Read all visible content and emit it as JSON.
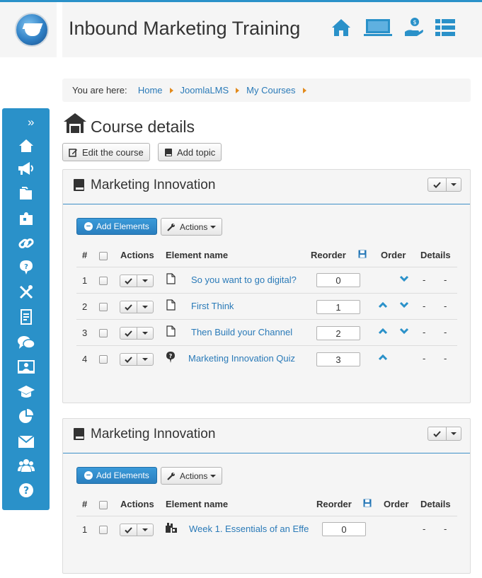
{
  "header": {
    "title": "Inbound Marketing Training",
    "icons": [
      "home-icon",
      "monitor-icon",
      "money-hand-icon",
      "list-icon"
    ]
  },
  "breadcrumb": {
    "prefix": "You are here:",
    "items": [
      "Home",
      "JoomlaLMS",
      "My Courses"
    ]
  },
  "sidebar": {
    "expand_glyph": "»",
    "icons": [
      "home-icon",
      "megaphone-icon",
      "folders-icon",
      "puzzle-icon",
      "link-icon",
      "help-bubble-icon",
      "tools-icon",
      "clipboard-icon",
      "chat-icon",
      "presentation-icon",
      "graduation-cap-icon",
      "pie-chart-icon",
      "mail-icon",
      "users-icon",
      "question-icon"
    ]
  },
  "page": {
    "title": "Course details",
    "edit_button": "Edit the course",
    "add_topic_button": "Add topic"
  },
  "columns": {
    "num": "#",
    "actions": "Actions",
    "element_name": "Element name",
    "reorder": "Reorder",
    "order": "Order",
    "details": "Details"
  },
  "topics": [
    {
      "title": "Marketing Innovation",
      "add_elements": "Add Elements",
      "actions": "Actions",
      "rows": [
        {
          "num": "1",
          "name": "So you want to go digital?",
          "icon": "document-icon",
          "reorder": "0",
          "up": false,
          "down": true,
          "d1": "-",
          "d2": "-"
        },
        {
          "num": "2",
          "name": "First Think",
          "icon": "document-icon",
          "reorder": "1",
          "up": true,
          "down": true,
          "d1": "-",
          "d2": "-"
        },
        {
          "num": "3",
          "name": "Then Build your Channel",
          "icon": "document-icon",
          "reorder": "2",
          "up": true,
          "down": true,
          "d1": "-",
          "d2": "-"
        },
        {
          "num": "4",
          "name": "Marketing Innovation Quiz",
          "icon": "quiz-icon",
          "reorder": "3",
          "up": true,
          "down": false,
          "d1": "-",
          "d2": "-"
        }
      ]
    },
    {
      "title": "Marketing Innovation",
      "add_elements": "Add Elements",
      "actions": "Actions",
      "rows": [
        {
          "num": "1",
          "name": "Week 1. Essentials of an Effe",
          "icon": "scorm-icon",
          "reorder": "0",
          "up": false,
          "down": false,
          "d1": "-",
          "d2": "-"
        }
      ]
    }
  ],
  "colors": {
    "accent": "#2a91c9",
    "link": "#2a7ab8",
    "panel_bg": "#f5f5f5",
    "breadcrumb_sep": "#e28a1c"
  }
}
